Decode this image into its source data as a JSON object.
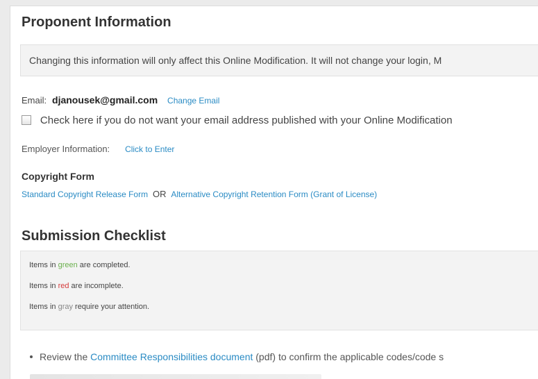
{
  "proponent": {
    "title": "Proponent Information",
    "notice": "Changing this information will only affect this Online Modification. It will not change your login, M",
    "email_label": "Email:",
    "email_value": "djanousek@gmail.com",
    "change_email": "Change Email",
    "email_checkbox_label": "Check here if you do not want your email address published with your Online Modification",
    "email_checkbox_checked": false,
    "employer_label": "Employer Information:",
    "employer_link": "Click to Enter"
  },
  "copyright": {
    "title": "Copyright Form",
    "standard_link": "Standard Copyright Release Form",
    "or_text": "OR",
    "alternative_link": "Alternative Copyright Retention Form (Grant of License)"
  },
  "checklist": {
    "title": "Submission Checklist",
    "legend": [
      {
        "prefix": "Items in ",
        "word": "green",
        "suffix": " are completed.",
        "color": "#6ab04c"
      },
      {
        "prefix": "Items in ",
        "word": "red",
        "suffix": " are incomplete.",
        "color": "#d63b3b"
      },
      {
        "prefix": "Items in ",
        "word": "gray",
        "suffix": " require your attention.",
        "color": "#888888"
      }
    ],
    "items": [
      {
        "prefix": "Review the ",
        "link": "Committee Responsibilities document",
        "suffix": " (pdf) to confirm the applicable codes/code s"
      }
    ]
  },
  "colors": {
    "link": "#2a8bc4",
    "panel_bg": "#f3f3f3",
    "page_bg": "#ebebeb"
  }
}
